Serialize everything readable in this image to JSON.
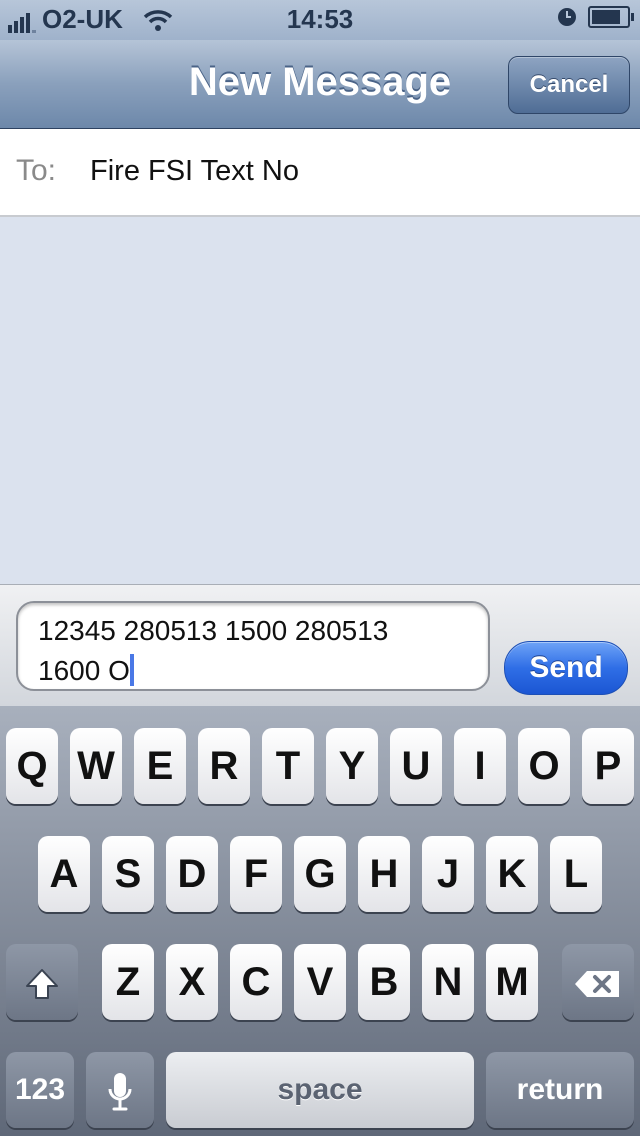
{
  "status_bar": {
    "carrier": "O2-UK",
    "time": "14:53",
    "signal_bars": 4
  },
  "nav": {
    "title": "New Message",
    "cancel_label": "Cancel"
  },
  "recipient": {
    "label": "To:",
    "value": "Fire FSI Text No"
  },
  "compose": {
    "text_line1": "12345 280513 1500 280513",
    "text_line2": "1600 O",
    "send_label": "Send"
  },
  "keyboard": {
    "row1": [
      "Q",
      "W",
      "E",
      "R",
      "T",
      "Y",
      "U",
      "I",
      "O",
      "P"
    ],
    "row2": [
      "A",
      "S",
      "D",
      "F",
      "G",
      "H",
      "J",
      "K",
      "L"
    ],
    "row3": [
      "Z",
      "X",
      "C",
      "V",
      "B",
      "N",
      "M"
    ],
    "numbers_label": "123",
    "space_label": "space",
    "return_label": "return",
    "icons": {
      "shift": "shift-icon",
      "delete": "backspace-icon",
      "mic": "microphone-icon"
    }
  }
}
